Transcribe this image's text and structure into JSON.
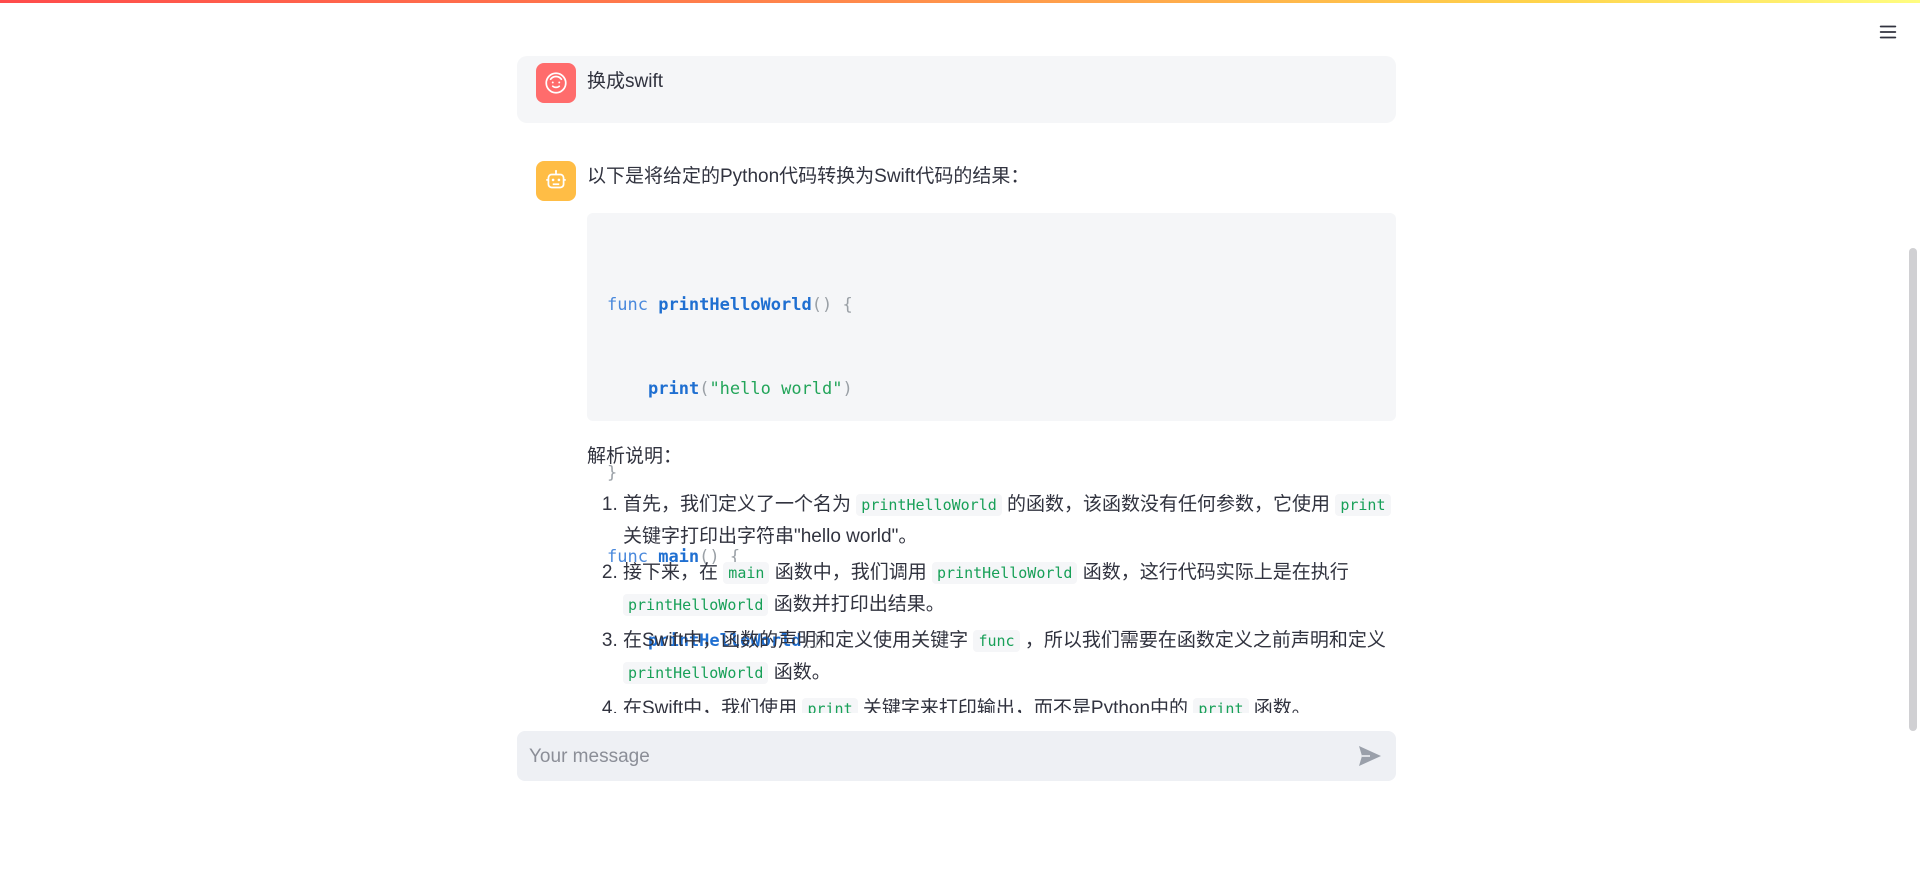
{
  "colors": {
    "user_avatar": "#ff6c6c",
    "assistant_avatar": "#ffbd45",
    "code_keyword": "#4a89dc",
    "code_function": "#1f6fd1",
    "code_string": "#23a55a",
    "inline_code": "#18a058"
  },
  "icons": {
    "menu": "hamburger-menu-icon",
    "user_avatar": "user-face-icon",
    "assistant_avatar": "robot-icon",
    "send": "send-icon"
  },
  "user_message": {
    "text": "换成swift"
  },
  "assistant_message": {
    "intro": "以下是将给定的Python代码转换为Swift代码的结果：",
    "code": {
      "line1": {
        "kw": "func",
        "fn": "printHelloWorld",
        "rest": "() {"
      },
      "line2": {
        "fn": "print",
        "open": "(",
        "str": "\"hello world\"",
        "close": ")"
      },
      "line3": {
        "rest": "}"
      },
      "line4": {
        "kw": "func",
        "fn": "main",
        "rest": "() {"
      },
      "line5": {
        "fn": "printHelloWorld",
        "rest": "()"
      },
      "line6": {
        "rest": "}"
      }
    },
    "section_title": "解析说明：",
    "notes": {
      "n1": {
        "a": "首先，我们定义了一个名为",
        "code1": "printHelloWorld",
        "b": "的函数，该函数没有任何参数，它使用",
        "code2": "print",
        "c": "关键字打印出字符串\"hello world\"。"
      },
      "n2": {
        "a": "接下来，在",
        "code1": "main",
        "b": "函数中，我们调用",
        "code2": "printHelloWorld",
        "c": "函数，这行代码实际上是在执行",
        "code3": "printHelloWorld",
        "d": "函数并打印出结果。"
      },
      "n3": {
        "a": "在Swift中，函数的声明和定义使用关键字",
        "code1": "func",
        "b": "，所以我们需要在函数定义之前声明和定义",
        "code2": "printHelloWorld",
        "c": "函数。"
      },
      "n4": {
        "a": "在Swift中，我们使用",
        "code1": "print",
        "b": "关键字来打印输出，而不是Python中的",
        "code2": "print",
        "c": "函数。"
      }
    }
  },
  "chat_input": {
    "placeholder": "Your message",
    "value": ""
  }
}
